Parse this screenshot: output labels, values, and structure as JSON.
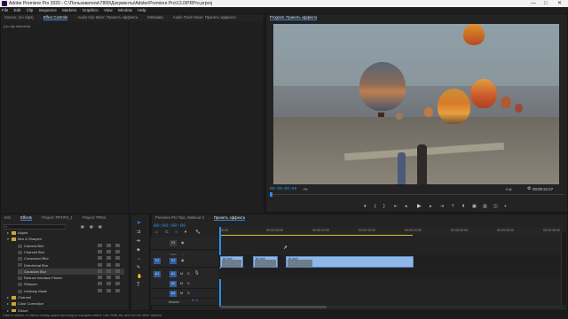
{
  "window": {
    "title": "Adobe Premiere Pro 2020 - C:\\Пользователи\\7899\\Документы\\Adobe\\Premiere Pro\\13.0\\PRPro.prproj",
    "minimize": "—",
    "maximize": "□",
    "close": "✕"
  },
  "menu": [
    "File",
    "Edit",
    "Clip",
    "Sequence",
    "Markers",
    "Graphics",
    "View",
    "Window",
    "Help"
  ],
  "source_panel": {
    "tabs": [
      "Source: (no clips)",
      "Effect Controls",
      "Audio Clip Mixer: Принять эффекта",
      "Metadata",
      "Audio Track Mixer: Принять эффекта"
    ],
    "active_tab": "Effect Controls",
    "empty_text": "(no clip selected)"
  },
  "program_monitor": {
    "tab": "Program: Принять эффекта",
    "timecode_current": "00:00:00:00",
    "fit": "Fit",
    "quality": "Full",
    "timecode_duration": "00:00:21:07"
  },
  "project_panel": {
    "tabs": [
      "Info",
      "Effects",
      "Project: PRTIP3_1",
      "Project: PRSs"
    ],
    "active_tab": "Effects",
    "effects_tree": [
      {
        "label": "Adjust",
        "level": 1,
        "kind": "folder"
      },
      {
        "label": "Blur & Sharpen",
        "level": 1,
        "kind": "folder-open"
      },
      {
        "label": "Camera Blur",
        "level": 2,
        "kind": "effect"
      },
      {
        "label": "Channel Blur",
        "level": 2,
        "kind": "effect"
      },
      {
        "label": "Compound Blur",
        "level": 2,
        "kind": "effect"
      },
      {
        "label": "Directional Blur",
        "level": 2,
        "kind": "effect"
      },
      {
        "label": "Gaussian Blur",
        "level": 2,
        "kind": "effect",
        "selected": true
      },
      {
        "label": "Reduce Interlace Flicker",
        "level": 2,
        "kind": "effect"
      },
      {
        "label": "Sharpen",
        "level": 2,
        "kind": "effect"
      },
      {
        "label": "Unsharp Mask",
        "level": 2,
        "kind": "effect"
      },
      {
        "label": "Channel",
        "level": 1,
        "kind": "folder"
      },
      {
        "label": "Color Correction",
        "level": 1,
        "kind": "folder"
      },
      {
        "label": "Distort",
        "level": 1,
        "kind": "folder"
      }
    ]
  },
  "timeline": {
    "tabs": [
      "Premiere Pro Tips, Webinar 3",
      "Принять эффекта"
    ],
    "active_tab": "Принять эффекта",
    "timecode": "00:00:00:00",
    "ruler_labels": [
      "00:00",
      "00:00:05:00",
      "00:00:10:00",
      "00:00:15:00",
      "00:00:20:00",
      "00:00:25:00",
      "00:00:30:00",
      "00:00:35:00"
    ],
    "video_tracks": [
      "V3",
      "V2",
      "V1"
    ],
    "audio_tracks": [
      "A1",
      "A2",
      "A3"
    ],
    "master": "Master",
    "master_value": "0.0",
    "clip_labels": [
      "Ш.mp4",
      "Ш.mp4",
      "Ш.mp4"
    ]
  },
  "status_bar": "Click to select, or click in empty space and drag to marquee select. Use Shift, Alt, and Ctrl for other options."
}
